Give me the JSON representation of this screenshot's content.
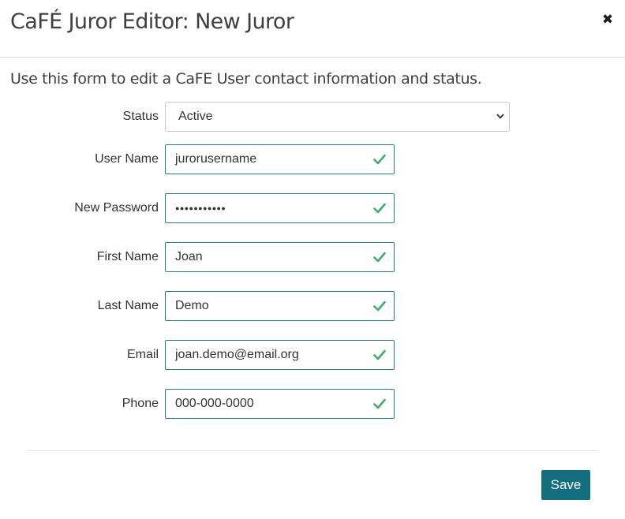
{
  "dialog": {
    "title": "CaFÉ Juror Editor: New Juror",
    "close_glyph": "✖",
    "intro": "Use this form to edit a CaFE User contact information and status."
  },
  "form": {
    "status": {
      "label": "Status",
      "value": "Active",
      "options_visible": [
        "Active"
      ]
    },
    "username": {
      "label": "User Name",
      "value": "jurorusername",
      "valid": true
    },
    "password": {
      "label": "New Password",
      "masked_value": "●●●●●●●●●●●",
      "valid": true
    },
    "first_name": {
      "label": "First Name",
      "value": "Joan",
      "valid": true
    },
    "last_name": {
      "label": "Last Name",
      "value": "Demo",
      "valid": true
    },
    "email": {
      "label": "Email",
      "value": "joan.demo@email.org",
      "valid": true
    },
    "phone": {
      "label": "Phone",
      "value": "000-000-0000",
      "valid": true
    }
  },
  "footer": {
    "save_label": "Save"
  },
  "colors": {
    "valid_border": "#1f8a5e",
    "check_mark": "#3cae6f",
    "save_button": "#136f7f"
  },
  "icons": {
    "close": "close-icon",
    "select_arrow": "chevron-down-icon",
    "valid": "check-icon"
  }
}
